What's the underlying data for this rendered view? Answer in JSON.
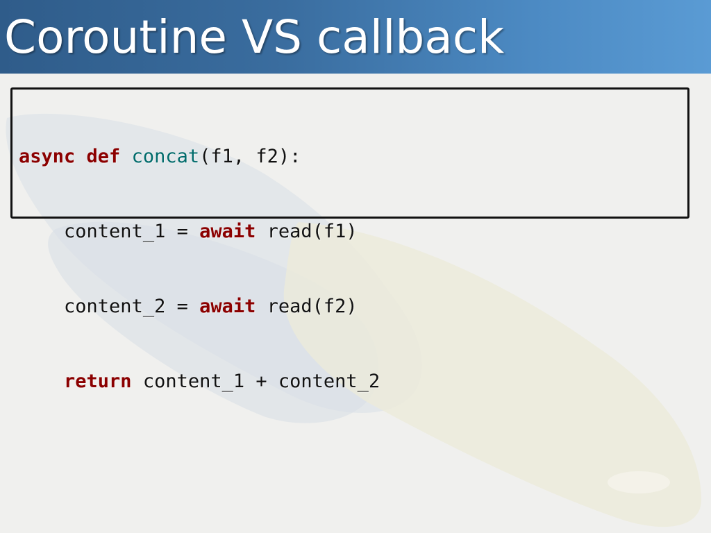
{
  "slide": {
    "title": "Coroutine VS callback"
  },
  "code": {
    "line1": {
      "kw1": "async",
      "kw2": "def",
      "fn": "concat",
      "rest": "(f1, f2):"
    },
    "line2": {
      "lhs": "content_1 = ",
      "kw": "await",
      "rhs": " read(f1)"
    },
    "line3": {
      "lhs": "content_2 = ",
      "kw": "await",
      "rhs": " read(f2)"
    },
    "line4": {
      "kw": "return",
      "rhs": " content_1 + content_2"
    }
  },
  "colors": {
    "title_bar_start": "#2f5c8a",
    "title_bar_end": "#5a9bd4",
    "keyword": "#8b0000",
    "function_name": "#006b6b",
    "background": "#f0f0ee"
  }
}
